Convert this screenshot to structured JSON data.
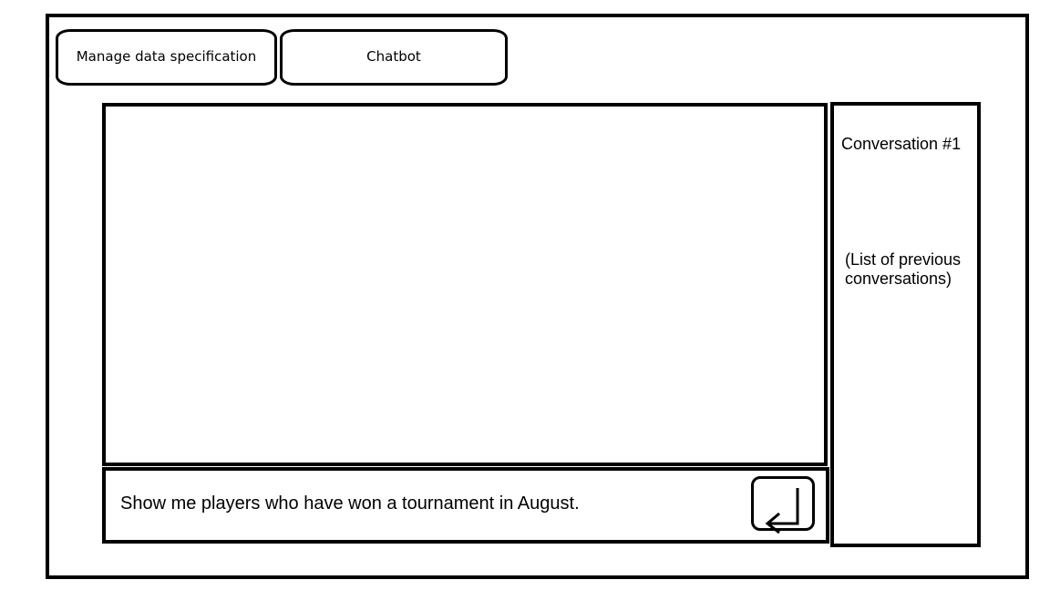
{
  "tabs": {
    "manage_label": "Manage data specification",
    "chatbot_label": "Chatbot"
  },
  "chat": {
    "input_value": "Show me players who have won a tournament in August.",
    "send_icon": "enter-return-icon"
  },
  "sidebar": {
    "conversation_label": "Conversation #1",
    "list_placeholder": "(List of previous conversations)"
  }
}
